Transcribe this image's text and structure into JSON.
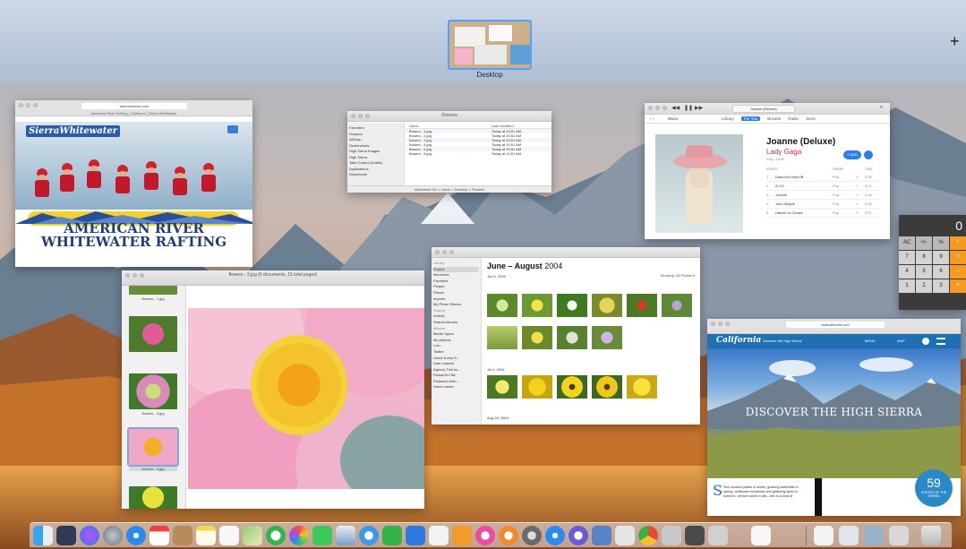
{
  "mission_control": {
    "space_label": "Desktop",
    "add_space_symbol": "+"
  },
  "colors": {
    "accent": "#2b7de9",
    "selection_border": "#4da3ff",
    "calculator_operator": "#f59a20",
    "california_blue": "#1f6fb3"
  },
  "safari_rafting": {
    "url": "americanriver.com",
    "tab_title": "American River Rafting | California | Sierra Whitewater",
    "logo": "SierraWhitewater",
    "headline_line1": "AMERICAN RIVER",
    "headline_line2": "WHITEWATER RAFTING"
  },
  "finder": {
    "title": "Flowers",
    "sidebar": [
      "Favorites",
      "Dropbox",
      "AirDrop",
      "Screenshots",
      "High Sierra Images",
      "High Sierra",
      "Take Control (Drafts)",
      "Applications",
      "Downloads"
    ],
    "columns": [
      "Name",
      "Date Modified"
    ],
    "rows": [
      {
        "name": "flowers - 1.jpg",
        "date": "Today at 10:51 AM"
      },
      {
        "name": "flowers - 2.jpg",
        "date": "Today at 10:51 AM"
      },
      {
        "name": "flowers - 3.jpg",
        "date": "Today at 10:51 AM"
      },
      {
        "name": "flowers - 4.jpg",
        "date": "Today at 10:51 AM"
      },
      {
        "name": "flowers - 5.jpg",
        "date": "Today at 10:51 AM"
      },
      {
        "name": "flowers - 6.jpg",
        "date": "Today at 10:51 AM"
      }
    ],
    "footer": "Macintosh HD > Users > Desktop > Flowers"
  },
  "itunes": {
    "lcd_line1": "Joanne (Deluxe)",
    "lcd_line2": "Lady Gaga",
    "source_menu": "Music",
    "tabs": [
      "Library",
      "For You",
      "Browse",
      "Radio",
      "Store"
    ],
    "active_tab": "For You",
    "album_title": "Joanne (Deluxe)",
    "artist": "Lady Gaga",
    "meta": "Pop • 2016",
    "add_label": "+ ADD",
    "track_headers": [
      "SONGS",
      "GENRE",
      "TIME"
    ],
    "tracks": [
      {
        "n": "1",
        "title": "Diamond Heart ⊞",
        "genre": "Pop",
        "time": "3:25"
      },
      {
        "n": "2",
        "title": "A-YO",
        "genre": "Pop",
        "time": "3:27"
      },
      {
        "n": "3",
        "title": "Joanne",
        "genre": "Pop",
        "time": "3:16"
      },
      {
        "n": "4",
        "title": "John Wayne",
        "genre": "Pop",
        "time": "2:54"
      },
      {
        "n": "5",
        "title": "Dancin' in Circles",
        "genre": "Pop",
        "time": "3:27"
      }
    ]
  },
  "calculator": {
    "display": "0",
    "keys": [
      "AC",
      "+/-",
      "%",
      "÷",
      "7",
      "8",
      "9",
      "×",
      "4",
      "5",
      "6",
      "−",
      "1",
      "2",
      "3",
      "+",
      "0",
      "",
      ".",
      "="
    ]
  },
  "preview": {
    "title": "flowers - 3.jpg (6 documents, 15 total pages)",
    "captions": [
      "flowers - 1.jpg",
      "flowers - 2.jpg",
      "flowers - 3.jpg",
      "flowers - 4.jpg"
    ]
  },
  "photos": {
    "title_bold": "June – August",
    "title_year": "2004",
    "showing": "Showing: All Photos ▾",
    "sidebar": [
      {
        "label": "Library",
        "header": true
      },
      {
        "label": "Photos",
        "selected": true
      },
      {
        "label": "Memories"
      },
      {
        "label": "Favorites"
      },
      {
        "label": "People"
      },
      {
        "label": "Places"
      },
      {
        "label": "Imports"
      },
      {
        "label": "My Photo Stream"
      },
      {
        "label": "Shared",
        "header": true
      },
      {
        "label": "Activity"
      },
      {
        "label": "Shared Albums"
      },
      {
        "label": "Albums",
        "header": true
      },
      {
        "label": "Media Types"
      },
      {
        "label": "My Albums"
      },
      {
        "label": "Lulu"
      },
      {
        "label": "Twitter"
      },
      {
        "label": "Home Every D..."
      },
      {
        "label": "Dale Ladecki"
      },
      {
        "label": "Agency Tick bo..."
      },
      {
        "label": "Rickard's Fills"
      },
      {
        "label": "Rickard's Anfn..."
      },
      {
        "label": "Home saved"
      }
    ],
    "sections": [
      "Jun 6, 2004",
      "Jul 4, 2004",
      "Aug 28, 2004"
    ]
  },
  "safari_california": {
    "url": "visitcalifornia.com",
    "logo": "California",
    "nav_discover": "Discover the High Sierra",
    "nav_menu": "MENU",
    "nav_map": "MAP",
    "headline": "DISCOVER THE HIGH SIERRA",
    "body_text": "See snowed peaks in winter, gushing waterfalls in spring, wildflower meadows and glittering lakes in summer, vibrant colors in fall—this is a land of",
    "badge_number": "59",
    "badge_label": "PHOTOS OF THE SIERRA"
  },
  "dock": {
    "apps": [
      "Finder",
      "Launchpad",
      "Siri",
      "Rocket",
      "Safari",
      "Calendar",
      "Notes",
      "Stickies",
      "Reminders",
      "Photos",
      "Messages",
      "FaceTime",
      "Photos Booth",
      "Preview",
      "Mail",
      "Numbers",
      "Keynote",
      "TextEdit",
      "Pages",
      "iTunes",
      "iBooks",
      "App Store",
      "System Preferences",
      "Utilities",
      "Chrome",
      "Automator",
      "Calculator",
      "Script Editor",
      "Documents",
      "Downloads",
      "Trash"
    ]
  }
}
